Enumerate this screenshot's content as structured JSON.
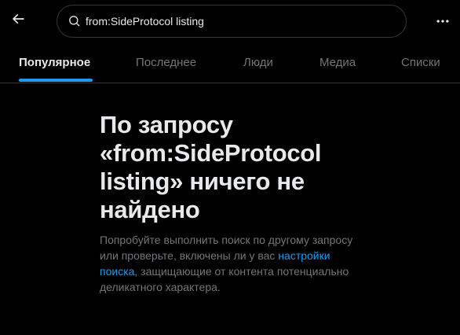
{
  "header": {
    "search_value": "from:SideProtocol listing",
    "back_icon": "arrow-left-icon",
    "search_icon": "search-icon",
    "more_icon": "more-horizontal-icon"
  },
  "tabs": [
    {
      "label": "Популярное",
      "active": true
    },
    {
      "label": "Последнее",
      "active": false
    },
    {
      "label": "Люди",
      "active": false
    },
    {
      "label": "Медиа",
      "active": false
    },
    {
      "label": "Списки",
      "active": false
    }
  ],
  "empty_state": {
    "title": "По запросу «from:SideProtocol listing» ничего не найдено",
    "text_before": "Попробуйте выполнить поиск по другому запросу или проверьте, включены ли у вас ",
    "link": "настройки поиска",
    "text_after": ", защищающие от контента потенциально деликатного характера."
  },
  "colors": {
    "background": "#000000",
    "accent": "#1d9bf0",
    "text_primary": "#e7e9ea",
    "text_secondary": "#71767b",
    "border": "#2f3336"
  }
}
